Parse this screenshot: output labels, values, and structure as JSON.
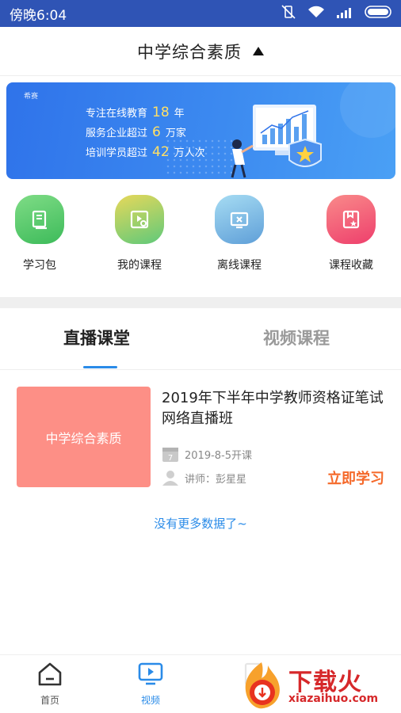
{
  "statusbar": {
    "time": "傍晚6:04"
  },
  "header": {
    "title": "中学综合素质"
  },
  "banner": {
    "brand": "希赛",
    "lines": [
      {
        "pre": "专注在线教育",
        "num": "18",
        "post": "年"
      },
      {
        "pre": "服务企业超过",
        "num": "6",
        "post": "万家"
      },
      {
        "pre": "培训学员超过",
        "num": "42",
        "post": "万人次"
      }
    ]
  },
  "quick": [
    {
      "label": "学习包",
      "icon": "book-icon",
      "color": "#5dc96f"
    },
    {
      "label": "我的课程",
      "icon": "play-user-icon",
      "color": "#9bd06a"
    },
    {
      "label": "离线课程",
      "icon": "offline-screen-icon",
      "color": "#7fbfe9"
    },
    {
      "label": "课程收藏",
      "icon": "favorite-box-icon",
      "color": "#f2637a"
    }
  ],
  "tabs": [
    {
      "label": "直播课堂",
      "active": true
    },
    {
      "label": "视频课程",
      "active": false
    }
  ],
  "course": {
    "thumb_text": "中学综合素质",
    "title": "2019年下半年中学教师资格证笔试网络直播班",
    "date": "2019-8-5开课",
    "teacher": "讲师：彭星星",
    "action": "立即学习"
  },
  "no_more": "没有更多数据了~",
  "nav": [
    {
      "label": "首页"
    },
    {
      "label": "视频"
    }
  ],
  "watermark": {
    "brand": "下载火",
    "url": "xiazaihuo.com"
  },
  "colors": {
    "accent": "#2a8be8",
    "statusbar": "#2f54b5",
    "action": "#f5692a",
    "thumb": "#fd8f86"
  }
}
